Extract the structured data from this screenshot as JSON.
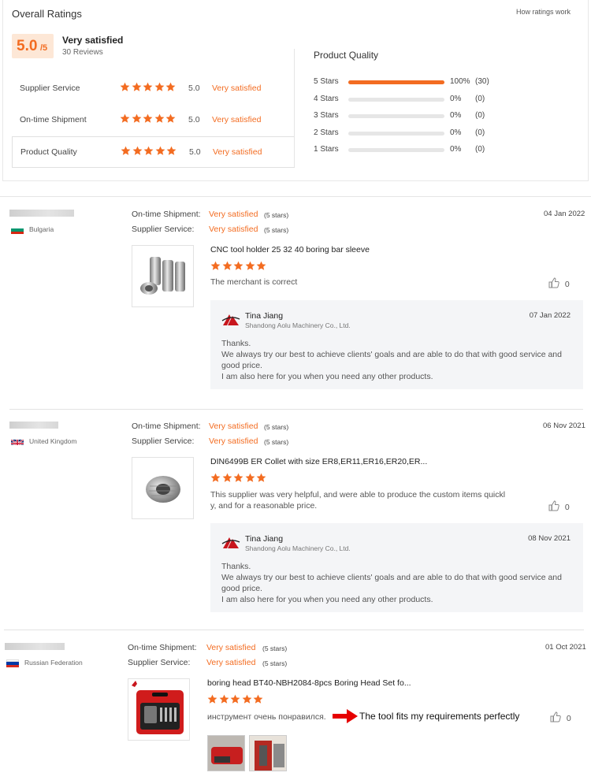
{
  "overall": {
    "title": "Overall Ratings",
    "how_link": "How ratings work",
    "score": "5.0",
    "score_max": "/5",
    "verdict": "Very satisfied",
    "reviews_count": "30 Reviews",
    "sub_ratings": [
      {
        "label": "Supplier Service",
        "value": "5.0",
        "verdict": "Very satisfied",
        "stars": 5
      },
      {
        "label": "On-time Shipment",
        "value": "5.0",
        "verdict": "Very satisfied",
        "stars": 5
      },
      {
        "label": "Product Quality",
        "value": "5.0",
        "verdict": "Very satisfied",
        "stars": 5
      }
    ],
    "quality_title": "Product Quality",
    "distribution": [
      {
        "label": "5 Stars",
        "fraction": 1.0,
        "pct": "100%",
        "count": "(30)"
      },
      {
        "label": "4 Stars",
        "fraction": 0,
        "pct": "0%",
        "count": "(0)"
      },
      {
        "label": "3 Stars",
        "fraction": 0,
        "pct": "0%",
        "count": "(0)"
      },
      {
        "label": "2 Stars",
        "fraction": 0,
        "pct": "0%",
        "count": "(0)"
      },
      {
        "label": "1 Stars",
        "fraction": 0,
        "pct": "0%",
        "count": "(0)"
      }
    ]
  },
  "colors": {
    "accent": "#f36c21",
    "reply_bg": "#f4f5f7"
  },
  "reviews": [
    {
      "country": "Bulgaria",
      "flag": "bulgaria-flag",
      "shipment_label": "On-time Shipment:",
      "shipment_verdict": "Very satisfied",
      "shipment_stars": "(5 stars)",
      "service_label": "Supplier Service:",
      "service_verdict": "Very satisfied",
      "service_stars": "(5 stars)",
      "date": "04 Jan 2022",
      "product_title": "CNC tool holder 25 32 40 boring bar sleeve",
      "rating": 5,
      "text": "The merchant is correct",
      "likes": "0",
      "reply": {
        "name": "Tina Jiang",
        "company": "Shandong Aolu Machinery Co., Ltd.",
        "date": "07 Jan 2022",
        "line1": "Thanks.",
        "line2": "We always try our best to achieve clients' goals and are able to do that with good service and good price.",
        "line3": "I am also here for you when you need any other products."
      }
    },
    {
      "country": "United Kingdom",
      "flag": "uk-flag",
      "shipment_label": "On-time Shipment:",
      "shipment_verdict": "Very satisfied",
      "shipment_stars": "(5 stars)",
      "service_label": "Supplier Service:",
      "service_verdict": "Very satisfied",
      "service_stars": "(5 stars)",
      "date": "06 Nov 2021",
      "product_title": "DIN6499B ER Collet with size ER8,ER11,ER16,ER20,ER...",
      "rating": 5,
      "text": "This supplier was very helpful, and were able to produce the custom items quickl y, and for a reasonable price.",
      "likes": "0",
      "reply": {
        "name": "Tina Jiang",
        "company": "Shandong Aolu Machinery Co., Ltd.",
        "date": "08 Nov 2021",
        "line1": "Thanks.",
        "line2": "We always try our best to achieve clients' goals and are able to do that with good service and good price.",
        "line3": "I am also here for you when you need any other products."
      }
    },
    {
      "country": "Russian Federation",
      "flag": "russia-flag",
      "shipment_label": "On-time Shipment:",
      "shipment_verdict": "Very satisfied",
      "shipment_stars": "(5 stars)",
      "service_label": "Supplier Service:",
      "service_verdict": "Very satisfied",
      "service_stars": "(5 stars)",
      "date": "01 Oct 2021",
      "product_title": "boring head BT40-NBH2084-8pcs Boring Head Set fo...",
      "rating": 5,
      "text": "инструмент очень понравился.",
      "annotation": "The tool fits my requirements perfectly",
      "likes": "0"
    }
  ]
}
